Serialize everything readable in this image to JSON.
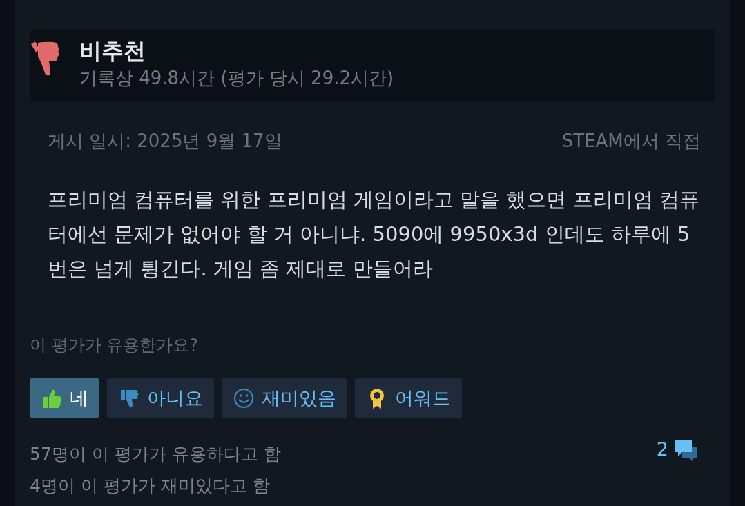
{
  "review": {
    "verdict": "비추천",
    "hours": "기록상 49.8시간 (평가 당시 29.2시간)",
    "recommended": false
  },
  "posted": "게시 일시: 2025년 9월 17일",
  "source": "STEAM에서 직접",
  "body": "프리미엄 컴퓨터를 위한 프리미엄 게임이라고 말을 했으면 프리미엄 컴퓨터에선 문제가 없어야 할 거 아니냐. 5090에 9950x3d 인데도 하루에 5번은 넘게 튕긴다. 게임 좀 제대로 만들어라",
  "question": "이 평가가 유용한가요?",
  "buttons": [
    {
      "kind": "yes",
      "label": "네",
      "selected": true
    },
    {
      "kind": "no",
      "label": "아니요",
      "selected": false
    },
    {
      "kind": "funny",
      "label": "재미있음",
      "selected": false
    },
    {
      "kind": "award",
      "label": "어워드",
      "selected": false
    }
  ],
  "stats": [
    "57명이 이 평가가 유용하다고 함",
    "4명이 이 평가가 재미있다고 함"
  ],
  "comments": "2"
}
